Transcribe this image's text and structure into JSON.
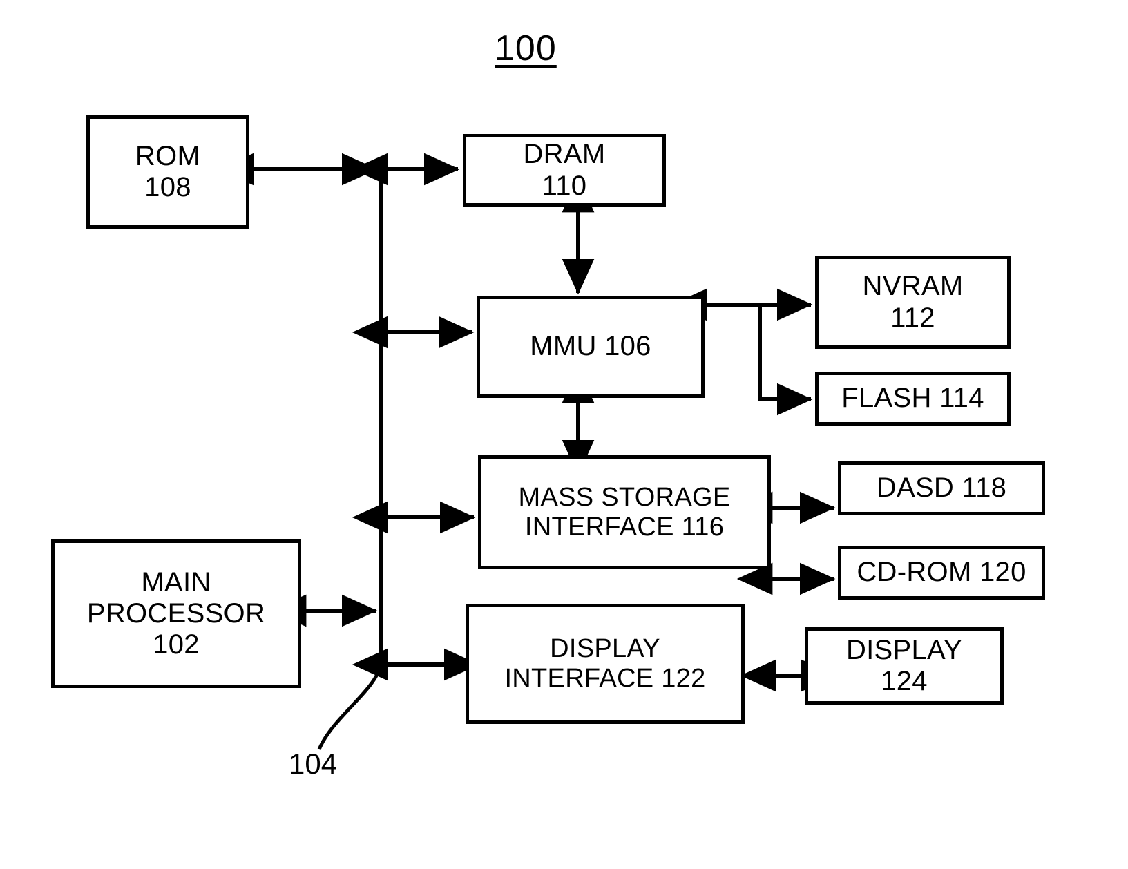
{
  "figure": {
    "number": "100",
    "bus_reference": "104"
  },
  "blocks": {
    "rom": {
      "label": "ROM\n108",
      "name": "ROM",
      "number": "108"
    },
    "dram": {
      "label": "DRAM\n110",
      "name": "DRAM",
      "number": "110"
    },
    "mmu": {
      "label": "MMU 106",
      "name": "MMU",
      "number": "106"
    },
    "nvram": {
      "label": "NVRAM\n112",
      "name": "NVRAM",
      "number": "112"
    },
    "flash": {
      "label": "FLASH 114",
      "name": "FLASH",
      "number": "114"
    },
    "mass_storage_interface": {
      "label": "MASS STORAGE\nINTERFACE 116",
      "name": "MASS STORAGE INTERFACE",
      "number": "116"
    },
    "dasd": {
      "label": "DASD 118",
      "name": "DASD",
      "number": "118"
    },
    "cdrom": {
      "label": "CD-ROM 120",
      "name": "CD-ROM",
      "number": "120"
    },
    "main_processor": {
      "label": "MAIN\nPROCESSOR\n102",
      "name": "MAIN PROCESSOR",
      "number": "102"
    },
    "display_interface": {
      "label": "DISPLAY\nINTERFACE 122",
      "name": "DISPLAY INTERFACE",
      "number": "122"
    },
    "display": {
      "label": "DISPLAY\n124",
      "name": "DISPLAY",
      "number": "124"
    }
  },
  "connections": [
    {
      "from": "rom",
      "to": "bus",
      "style": "bidirectional"
    },
    {
      "from": "bus",
      "to": "dram",
      "style": "bidirectional"
    },
    {
      "from": "dram",
      "to": "mmu",
      "style": "bidirectional"
    },
    {
      "from": "bus",
      "to": "mmu",
      "style": "bidirectional"
    },
    {
      "from": "mmu",
      "to": "nvram",
      "style": "bidirectional"
    },
    {
      "from": "mmu",
      "to": "flash",
      "style": "unidirectional"
    },
    {
      "from": "mmu",
      "to": "mass_storage_interface",
      "style": "bidirectional"
    },
    {
      "from": "bus",
      "to": "mass_storage_interface",
      "style": "bidirectional"
    },
    {
      "from": "mass_storage_interface",
      "to": "dasd",
      "style": "bidirectional"
    },
    {
      "from": "mass_storage_interface",
      "to": "cdrom",
      "style": "bidirectional"
    },
    {
      "from": "main_processor",
      "to": "bus",
      "style": "bidirectional"
    },
    {
      "from": "bus",
      "to": "display_interface",
      "style": "bidirectional"
    },
    {
      "from": "display_interface",
      "to": "display",
      "style": "bidirectional"
    }
  ],
  "colors": {
    "line": "#000000",
    "background": "#ffffff",
    "text": "#000000"
  }
}
